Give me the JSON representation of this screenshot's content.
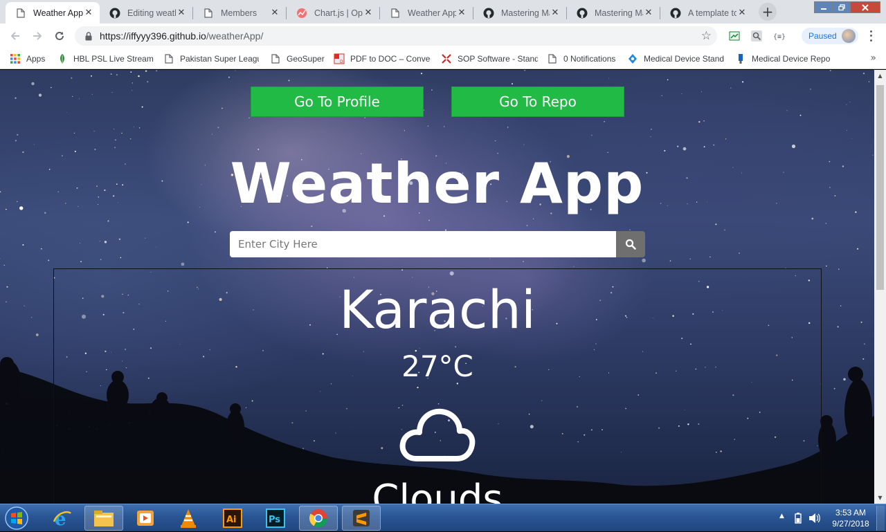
{
  "browser": {
    "tabs": [
      {
        "title": "Weather App",
        "icon": "page-icon",
        "active": true
      },
      {
        "title": "Editing weath",
        "icon": "github-icon",
        "active": false
      },
      {
        "title": "Members",
        "icon": "page-icon",
        "active": false
      },
      {
        "title": "Chart.js | Ope",
        "icon": "chartjs-icon",
        "active": false
      },
      {
        "title": "Weather App",
        "icon": "page-icon",
        "active": false
      },
      {
        "title": "Mastering Ma",
        "icon": "github-icon",
        "active": false
      },
      {
        "title": "Mastering Ma",
        "icon": "github-icon",
        "active": false
      },
      {
        "title": "A template to",
        "icon": "github-icon",
        "active": false
      }
    ],
    "new_tab_label": "+",
    "url_host": "https://iffyyy396.github.io",
    "url_path": "/weatherApp/",
    "profile_label": "Paused",
    "bookmarks": [
      {
        "label": "Apps",
        "icon": "apps-grid-icon"
      },
      {
        "label": "HBL PSL Live Streamin",
        "icon": "hbl-leaf-icon"
      },
      {
        "label": "Pakistan Super League",
        "icon": "page-icon"
      },
      {
        "label": "GeoSuper",
        "icon": "page-icon"
      },
      {
        "label": "PDF to DOC – Conver",
        "icon": "pdf-icon"
      },
      {
        "label": "SOP Software - Stand",
        "icon": "sop-icon"
      },
      {
        "label": "0 Notifications",
        "icon": "page-icon"
      },
      {
        "label": "Medical Device Stand",
        "icon": "medical-device-icon"
      },
      {
        "label": "Medical Device Repo",
        "icon": "medical-report-icon"
      }
    ],
    "bookmarks_more": "»"
  },
  "page": {
    "profile_button": "Go To Profile",
    "repo_button": "Go To Repo",
    "title": "Weather App",
    "search_placeholder": "Enter City Here",
    "city": "Karachi",
    "temperature": "27°C",
    "condition_icon": "cloud-icon",
    "condition": "Clouds",
    "accent_color": "#21ba45"
  },
  "taskbar": {
    "apps": [
      {
        "name": "ie-icon",
        "open": false
      },
      {
        "name": "file-explorer-icon",
        "open": true
      },
      {
        "name": "media-player-icon",
        "open": false
      },
      {
        "name": "vlc-icon",
        "open": false
      },
      {
        "name": "illustrator-icon",
        "label": "Ai",
        "open": false
      },
      {
        "name": "photoshop-icon",
        "label": "Ps",
        "open": false
      },
      {
        "name": "chrome-icon",
        "open": true
      },
      {
        "name": "sublime-icon",
        "open": true
      }
    ],
    "time": "3:53 AM",
    "date": "9/27/2018"
  }
}
